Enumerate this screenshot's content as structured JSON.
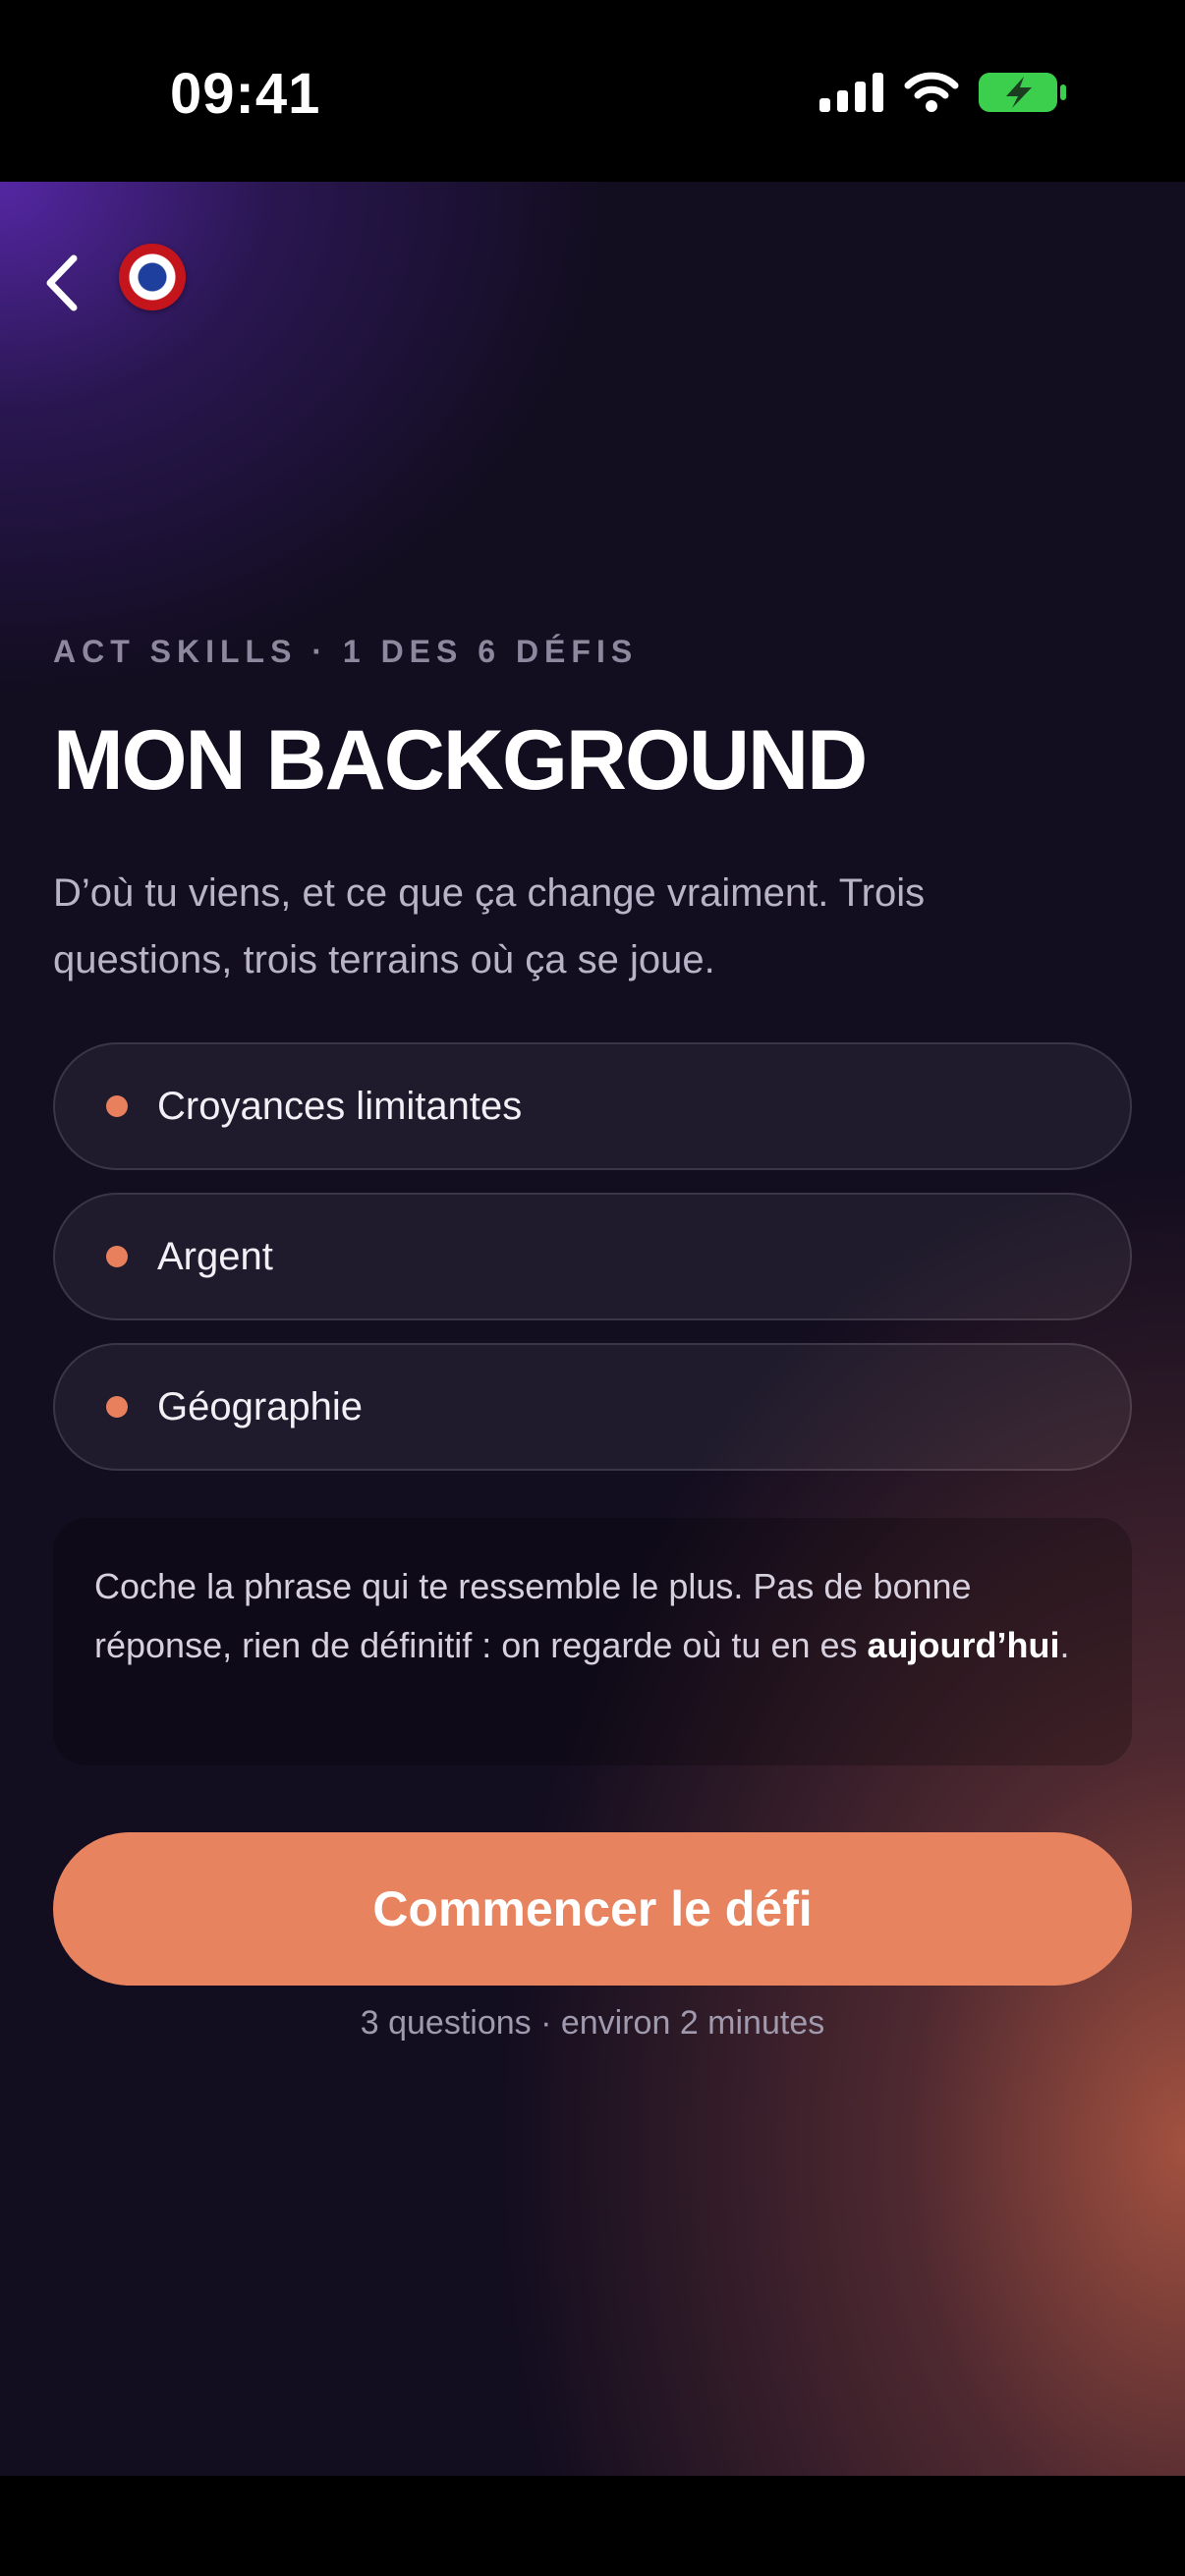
{
  "status_bar": {
    "time": "09:41",
    "icons": [
      "cellular-signal-icon",
      "wifi-icon",
      "battery-charging-icon"
    ],
    "battery_color": "#3ccf4e"
  },
  "nav": {
    "back_icon": "chevron-left-icon",
    "badge_icon": "french-cocarde-icon"
  },
  "header": {
    "eyebrow": "ACT SKILLS · 1 DES 6 DÉFIS",
    "title": "MON BACKGROUND",
    "subtitle": "D’où tu viens, et ce que ça change vraiment. Trois questions, trois terrains où ça se joue."
  },
  "topics": [
    {
      "label": "Croyances limitantes"
    },
    {
      "label": "Argent"
    },
    {
      "label": "Géographie"
    }
  ],
  "note": {
    "text": "Coche la phrase qui te ressemble le plus. Pas de bonne réponse, rien de définitif : on regarde où tu en es ",
    "emphasis": "aujourd’hui",
    "end": "."
  },
  "cta": {
    "label": "Commencer le défi",
    "meta": "3 questions · environ 2 minutes"
  },
  "colors": {
    "accent": "#e8835f",
    "background": "#120d1f",
    "purple_glow": "#5828aa"
  }
}
